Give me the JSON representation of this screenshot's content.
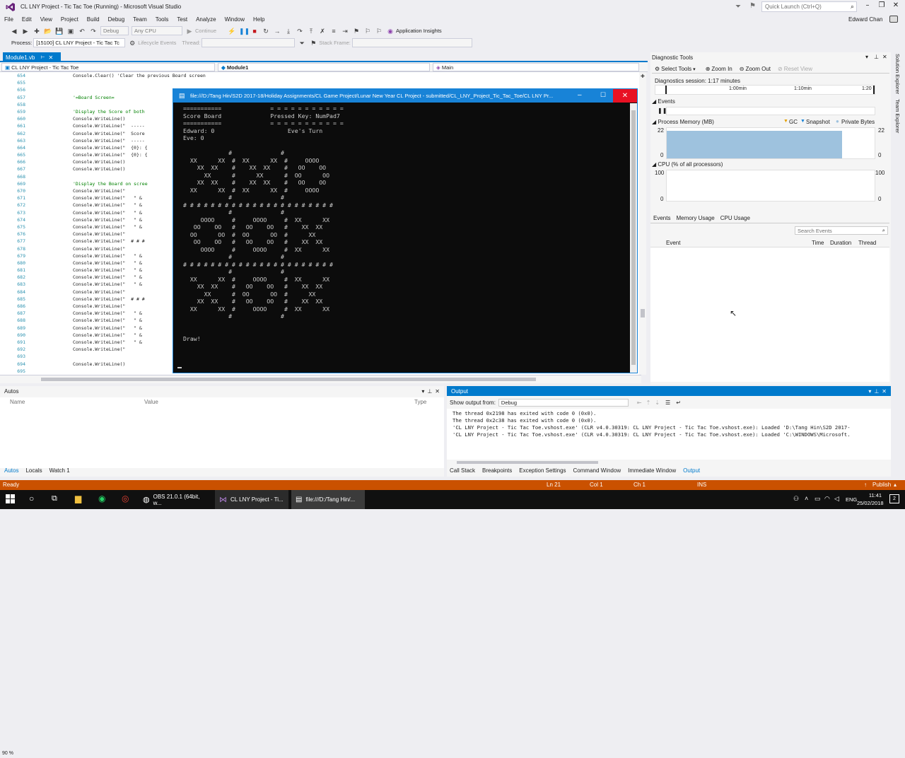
{
  "window": {
    "title": "CL LNY Project - Tic Tac Toe (Running) - Microsoft Visual Studio",
    "quick_launch_placeholder": "Quick Launch (Ctrl+Q)",
    "user": "Edward Chan"
  },
  "menu": [
    "File",
    "Edit",
    "View",
    "Project",
    "Build",
    "Debug",
    "Team",
    "Tools",
    "Test",
    "Analyze",
    "Window",
    "Help"
  ],
  "toolbar": {
    "config": "Debug",
    "platform": "Any CPU",
    "continue_label": "Continue",
    "app_insights": "Application Insights",
    "process_label": "Process:",
    "process_value": "[15100] CL LNY Project - Tic Tac Tc",
    "lifecycle_label": "Lifecycle Events",
    "thread_label": "Thread:",
    "stack_frame_label": "Stack Frame:"
  },
  "editor": {
    "tab_label": "Module1.vb",
    "nav_project": "CL LNY Project - Tic Tac Toe",
    "nav_module": "Module1",
    "nav_method": "Main",
    "zoom": "90 %",
    "line_numbers": [
      "654",
      "655",
      "656",
      "657",
      "658",
      "659",
      "660",
      "661",
      "662",
      "663",
      "664",
      "665",
      "666",
      "667",
      "668",
      "669",
      "670",
      "671",
      "672",
      "673",
      "674",
      "675",
      "676",
      "677",
      "678",
      "679",
      "680",
      "681",
      "682",
      "683",
      "684",
      "685",
      "686",
      "687",
      "688",
      "689",
      "690",
      "691",
      "692",
      "693",
      "694",
      "695"
    ],
    "lines": [
      "            Console.Clear() 'Clear the previous Board screen",
      "",
      "",
      "            '=Board Screen=",
      "",
      "            'Display the Score of both",
      "            Console.WriteLine()",
      "            Console.WriteLine(\"  -----",
      "            Console.WriteLine(\"  Score",
      "            Console.WriteLine(\"  -----",
      "            Console.WriteLine(\"  {0}: {",
      "            Console.WriteLine(\"  {0}: {",
      "            Console.WriteLine()",
      "            Console.WriteLine()",
      "",
      "            'Display the Board on scree",
      "            Console.WriteLine(\"",
      "            Console.WriteLine(\"   \" &",
      "            Console.WriteLine(\"   \" &",
      "            Console.WriteLine(\"   \" &",
      "            Console.WriteLine(\"   \" &",
      "            Console.WriteLine(\"   \" &",
      "            Console.WriteLine(\"",
      "            Console.WriteLine(\"  # # #",
      "            Console.WriteLine(\"",
      "            Console.WriteLine(\"   \" &",
      "            Console.WriteLine(\"   \" &",
      "            Console.WriteLine(\"   \" &",
      "            Console.WriteLine(\"   \" &",
      "            Console.WriteLine(\"   \" &",
      "            Console.WriteLine(\"",
      "            Console.WriteLine(\"  # # #",
      "            Console.WriteLine(\"",
      "            Console.WriteLine(\"   \" &",
      "            Console.WriteLine(\"   \" &",
      "            Console.WriteLine(\"   \" &",
      "            Console.WriteLine(\"   \" &",
      "            Console.WriteLine(\"   \" &",
      "            Console.WriteLine(\"",
      "",
      "            Console.WriteLine()",
      ""
    ]
  },
  "console": {
    "title": "file:///D:/Tang Hin/S2D 2017-18/Holiday Assignments/CL Game Project/Lunar New Year CL Project - submitted/CL_LNY_Project_Tic_Tac_Toe/CL LNY Pr...",
    "lines": [
      "===========              = = = = = = = = = = =",
      "Score Board              Pressed Key: NumPad7",
      "===========              = = = = = = = = = = =",
      "Edward: 0                     Eve's Turn",
      "Eve: 0",
      "",
      "             #              #",
      "  XX      XX  #  XX      XX  #     OOOO",
      "    XX  XX    #    XX  XX    #   OO    OO",
      "      XX      #      XX      #  OO      OO",
      "    XX  XX    #    XX  XX    #   OO    OO",
      "  XX      XX  #  XX      XX  #     OOOO",
      "             #              #",
      "# # # # # # # # # # # # # # # # # # # # # #",
      "             #              #",
      "     OOOO     #     OOOO     #  XX      XX",
      "   OO    OO   #   OO    OO   #    XX  XX",
      "  OO      OO  #  OO      OO  #      XX",
      "   OO    OO   #   OO    OO   #    XX  XX",
      "     OOOO     #     OOOO     #  XX      XX",
      "             #              #",
      "# # # # # # # # # # # # # # # # # # # # # #",
      "             #              #",
      "  XX      XX  #     OOOO     #  XX      XX",
      "    XX  XX    #   OO    OO   #    XX  XX",
      "      XX      #  OO      OO  #      XX",
      "    XX  XX    #   OO    OO   #    XX  XX",
      "  XX      XX  #     OOOO     #  XX      XX",
      "             #              #",
      "",
      "",
      "Draw!"
    ]
  },
  "diagnostics": {
    "title": "Diagnostic Tools",
    "select_tools": "Select Tools",
    "zoom_in": "Zoom In",
    "zoom_out": "Zoom Out",
    "reset_view": "Reset View",
    "session": "Diagnostics session: 1:17 minutes",
    "timeline": [
      "1:00min",
      "1:10min",
      "1:20"
    ],
    "events_label": "Events",
    "process_memory_label": "Process Memory (MB)",
    "gc": "GC",
    "snapshot": "Snapshot",
    "private_bytes": "Private Bytes",
    "mem_max": "22",
    "mem_min": "0",
    "memory_value": 20,
    "cpu_label": "CPU (% of all processors)",
    "cpu_max": "100",
    "cpu_min": "0",
    "tabs": [
      "Events",
      "Memory Usage",
      "CPU Usage"
    ],
    "search_placeholder": "Search Events",
    "columns": [
      "Event",
      "Time",
      "Duration",
      "Thread"
    ]
  },
  "right_strip": [
    "Solution Explorer",
    "Team Explorer"
  ],
  "autos": {
    "title": "Autos",
    "columns": [
      "Name",
      "Value",
      "Type"
    ],
    "tabs": [
      "Autos",
      "Locals",
      "Watch 1"
    ]
  },
  "output": {
    "title": "Output",
    "show_from_label": "Show output from:",
    "show_from_value": "Debug",
    "lines": [
      "The thread 0x2198 has exited with code 0 (0x0).",
      "The thread 0x2c38 has exited with code 0 (0x0).",
      "'CL LNY Project - Tic Tac Toe.vshost.exe' (CLR v4.0.30319: CL LNY Project - Tic Tac Toe.vshost.exe): Loaded 'D:\\Tang Hin\\S2D 2017-",
      "'CL LNY Project - Tic Tac Toe.vshost.exe' (CLR v4.0.30319: CL LNY Project - Tic Tac Toe.vshost.exe): Loaded 'C:\\WINDOWS\\Microsoft."
    ],
    "tabs": [
      "Call Stack",
      "Breakpoints",
      "Exception Settings",
      "Command Window",
      "Immediate Window",
      "Output"
    ]
  },
  "status": {
    "ready": "Ready",
    "ln": "Ln 21",
    "col": "Col 1",
    "ch": "Ch 1",
    "ins": "INS",
    "publish": "Publish"
  },
  "taskbar": {
    "apps": [
      "OBS 21.0.1 (64bit, w...",
      "CL LNY Project - Ti...",
      "file:///D:/Tang Hin/..."
    ],
    "lang": "ENG",
    "time": "11:41",
    "date": "25/02/2018",
    "notif_count": "2"
  },
  "colors": {
    "accent": "#007ACC",
    "status_bar": "#CA5100",
    "console_title": "#1883D7",
    "close_red": "#E81123"
  }
}
